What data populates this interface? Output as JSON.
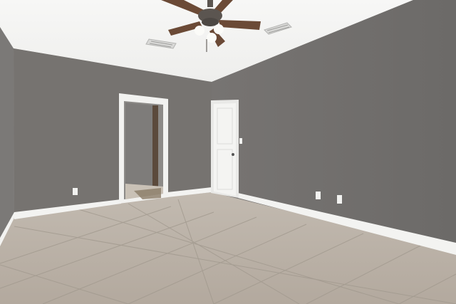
{
  "scene": {
    "colors": {
      "ceiling": "#f4f4f2",
      "wall_left": "#7d7b79",
      "wall_back": "#75726f",
      "wall_right": "#6f6d6b",
      "trim": "#f7f7f5",
      "floor": "#b7aea3",
      "grout": "#9d958a",
      "door": "#f0f0ee",
      "fan_blade": "#6b4a36",
      "fan_metal": "#5b5550"
    },
    "elements": {
      "ceiling": "ceiling",
      "left_wall": "left-wall",
      "back_wall": "back-wall",
      "right_wall": "right-wall",
      "floor": "tile-floor",
      "doorway": "open-doorway",
      "door": "closed-door",
      "fan": "ceiling-fan",
      "vents": "air-vent",
      "outlets": "wall-outlet",
      "baseboard": "baseboard",
      "light_switch": "light-switch"
    }
  }
}
